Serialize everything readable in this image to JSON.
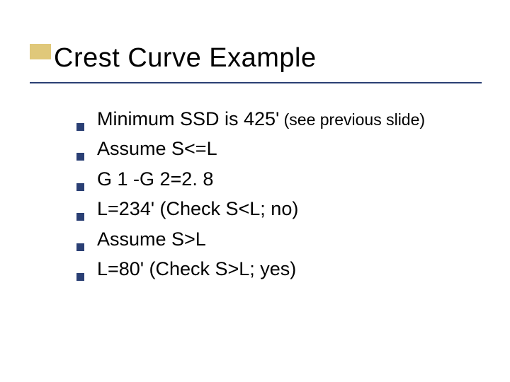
{
  "slide": {
    "title": "Crest Curve Example",
    "bullets": [
      {
        "text": "Minimum SSD is 425'",
        "note": " (see previous slide)"
      },
      {
        "text": "Assume S<=L",
        "note": ""
      },
      {
        "text": "G 1 -G 2=2. 8",
        "note": ""
      },
      {
        "text": "L=234' (Check S<L; no)",
        "note": ""
      },
      {
        "text": "Assume S>L",
        "note": ""
      },
      {
        "text": "L=80' (Check S>L; yes)",
        "note": ""
      }
    ]
  }
}
